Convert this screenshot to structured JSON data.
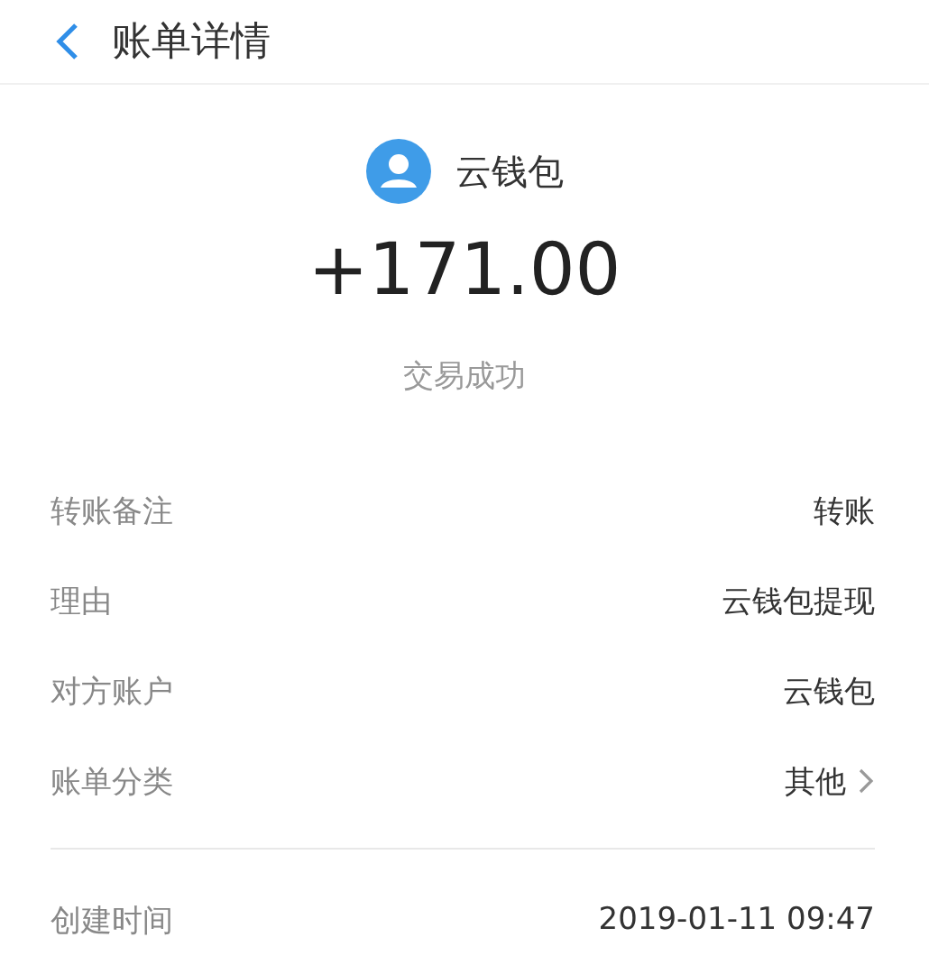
{
  "header": {
    "title": "账单详情"
  },
  "summary": {
    "payee": "云钱包",
    "amount": "+171.00",
    "status": "交易成功"
  },
  "details": [
    {
      "label": "转账备注",
      "value": "转账",
      "kind": "plain"
    },
    {
      "label": "理由",
      "value": "云钱包提现",
      "kind": "plain"
    },
    {
      "label": "对方账户",
      "value": "云钱包",
      "kind": "plain"
    },
    {
      "label": "账单分类",
      "value": "其他",
      "kind": "link"
    }
  ],
  "footer_details": [
    {
      "label": "创建时间",
      "value": "2019-01-11 09:47"
    }
  ]
}
